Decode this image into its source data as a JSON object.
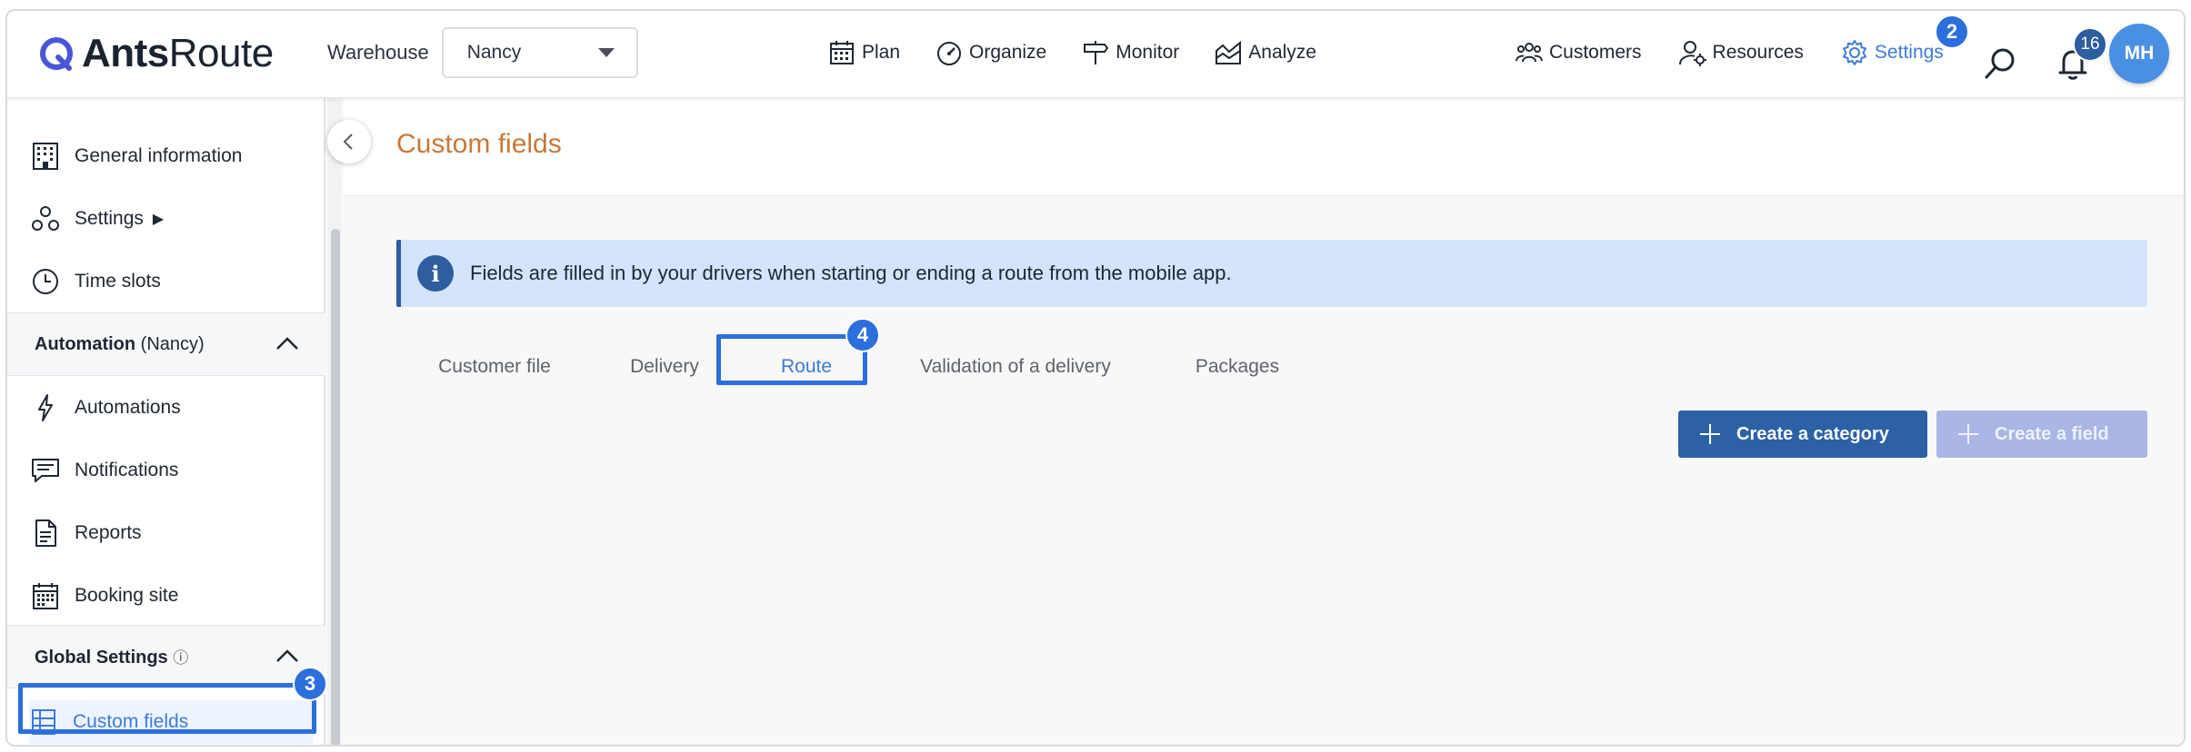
{
  "app": {
    "logo_bold": "Ants",
    "logo_light": "Route"
  },
  "header": {
    "warehouse_label": "Warehouse",
    "warehouse_value": "Nancy",
    "nav_center": [
      {
        "label": "Plan",
        "icon": "calendar-icon"
      },
      {
        "label": "Organize",
        "icon": "gauge-icon"
      },
      {
        "label": "Monitor",
        "icon": "signpost-icon"
      },
      {
        "label": "Analyze",
        "icon": "chart-icon"
      }
    ],
    "nav_right": [
      {
        "label": "Customers",
        "icon": "users-icon"
      },
      {
        "label": "Resources",
        "icon": "user-gear-icon"
      },
      {
        "label": "Settings",
        "icon": "gear-icon"
      }
    ],
    "notification_count": "16",
    "avatar_initials": "MH"
  },
  "sidebar": {
    "items_top": [
      {
        "label": "General information",
        "icon": "building-icon"
      },
      {
        "label": "Settings",
        "icon": "settings-cluster-icon",
        "suffix": "▶"
      },
      {
        "label": "Time slots",
        "icon": "clock-icon"
      }
    ],
    "automation_section": {
      "title": "Automation",
      "subtitle": "(Nancy)"
    },
    "items_automation": [
      {
        "label": "Automations",
        "icon": "lightning-icon"
      },
      {
        "label": "Notifications",
        "icon": "message-icon"
      },
      {
        "label": "Reports",
        "icon": "document-icon"
      },
      {
        "label": "Booking site",
        "icon": "calendar-grid-icon"
      }
    ],
    "global_section": {
      "title": "Global Settings",
      "info": "ⓘ"
    },
    "items_global": [
      {
        "label": "Custom fields",
        "icon": "table-icon",
        "active": true
      }
    ]
  },
  "main": {
    "title": "Custom fields",
    "info_icon": "i",
    "info_text": "Fields are filled in by your drivers when starting or ending a route from the mobile app.",
    "tabs": [
      {
        "label": "Customer file",
        "active": false
      },
      {
        "label": "Delivery",
        "active": false
      },
      {
        "label": "Route",
        "active": true
      },
      {
        "label": "Validation of a delivery",
        "active": false
      },
      {
        "label": "Packages",
        "active": false
      }
    ],
    "create_category_label": "Create a category",
    "create_field_label": "Create a field"
  },
  "annotations": {
    "settings_step": "2",
    "custom_fields_step": "3",
    "route_tab_step": "4"
  },
  "colors": {
    "accent": "#3d7bd8",
    "highlight": "#2b6fdc",
    "title_orange": "#c8783a",
    "primary_button": "#2c61a6",
    "disabled_button": "#aab6e4",
    "info_background": "#d3e4fb"
  }
}
